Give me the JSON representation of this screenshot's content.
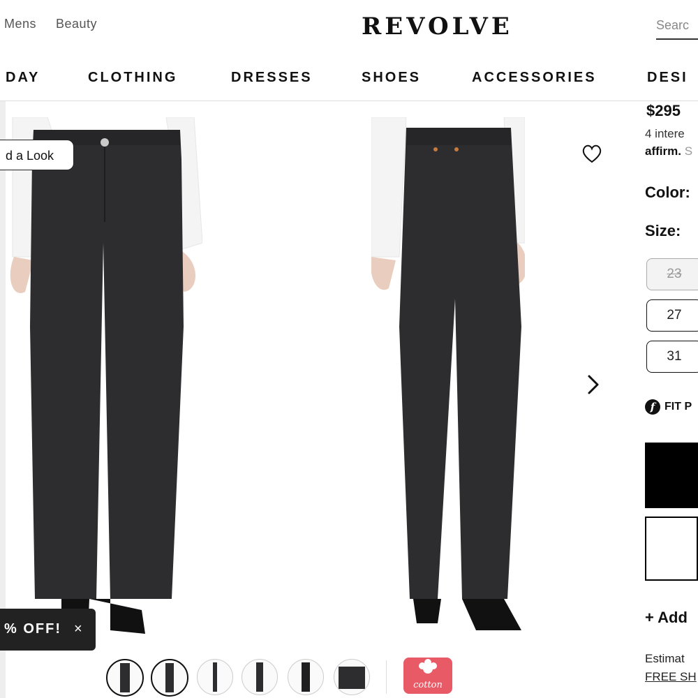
{
  "top": {
    "links": [
      "Mens",
      "Beauty"
    ],
    "logo": "REVOLVE",
    "search_placeholder": "Searc"
  },
  "nav": {
    "items": [
      "DAY",
      "CLOTHING",
      "DRESSES",
      "SHOES",
      "ACCESSORIES",
      "DESI"
    ]
  },
  "gallery": {
    "find_look_label": "d a Look",
    "promo_text": "% OFF!",
    "promo_close": "×",
    "cotton_badge": "cotton",
    "thumbnail_count": 6
  },
  "product": {
    "price": "$295",
    "installments_text": "4 intere",
    "affirm_logo": "affirm.",
    "affirm_suffix": "S",
    "color_label": "Color:",
    "size_label": "Size:",
    "sizes": [
      {
        "label": "23",
        "available": false
      },
      {
        "label": "27",
        "available": true
      },
      {
        "label": "31",
        "available": true
      }
    ],
    "fit_label": "FIT P",
    "add_to_list": "+ Add",
    "estimate_text": "Estimat",
    "free_shipping": "FREE SH"
  },
  "colors": {
    "denim": "#2d2d2f",
    "promo_bg": "#222222",
    "cotton_badge": "#e85a66"
  }
}
